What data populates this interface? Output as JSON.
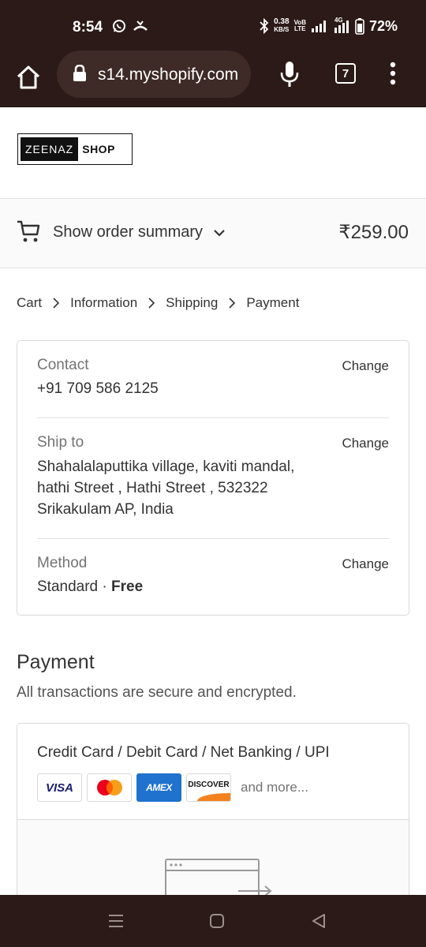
{
  "status_bar": {
    "time": "8:54",
    "speed_value": "0.38",
    "speed_unit": "KB/S",
    "volte_top": "VoB",
    "volte_bottom": "LTE",
    "network_type": "4G",
    "battery": "72%"
  },
  "browser": {
    "url": "s14.myshopify.com",
    "tab_count": "7"
  },
  "shop": {
    "logo_dark": "ZEENAZ",
    "logo_light": "SHOP"
  },
  "order_summary": {
    "label": "Show order summary",
    "total": "₹259.00"
  },
  "breadcrumb": {
    "items": [
      "Cart",
      "Information",
      "Shipping",
      "Payment"
    ]
  },
  "review": {
    "contact_label": "Contact",
    "contact_value": "+91 709 586 2125",
    "ship_label": "Ship to",
    "ship_lines": [
      "Shahalalaputtika village, kaviti mandal,",
      "hathi Street , Hathi Street , 532322",
      "Srikakulam AP, India"
    ],
    "method_label": "Method",
    "method_name": "Standard · ",
    "method_price": "Free",
    "change_label": "Change"
  },
  "payment": {
    "title": "Payment",
    "subtitle": "All transactions are secure and encrypted.",
    "method": "Credit Card / Debit Card / Net Banking / UPI",
    "card_visa": "VISA",
    "card_amex": "AMEX",
    "card_discover": "DISCOVER",
    "and_more": "and more..."
  },
  "colors": {
    "system_bar": "#2b1a17",
    "url_pill": "#3e2a26",
    "amex_blue": "#1f72cd",
    "discover_orange": "#f48120"
  }
}
